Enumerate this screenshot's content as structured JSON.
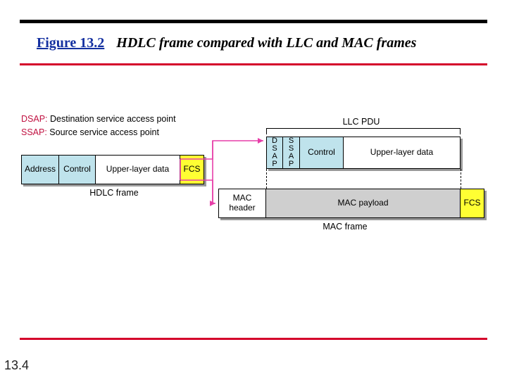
{
  "figure": {
    "label": "Figure 13.2",
    "caption": "HDLC frame compared with LLC and MAC frames"
  },
  "page_number": "13.4",
  "definitions": {
    "dsap_term": "DSAP:",
    "dsap_text": " Destination service access point",
    "ssap_term": "SSAP:",
    "ssap_text": " Source service access point"
  },
  "hdlc": {
    "address": "Address",
    "control": "Control",
    "data": "Upper-layer data",
    "fcs": "FCS",
    "caption": "HDLC frame"
  },
  "llc": {
    "pdu_label": "LLC PDU",
    "dsap_letters": [
      "D",
      "S",
      "A",
      "P"
    ],
    "ssap_letters": [
      "S",
      "S",
      "A",
      "P"
    ],
    "control": "Control",
    "data": "Upper-layer data"
  },
  "mac": {
    "header": "MAC header",
    "payload": "MAC payload",
    "fcs": "FCS",
    "caption": "MAC frame"
  }
}
